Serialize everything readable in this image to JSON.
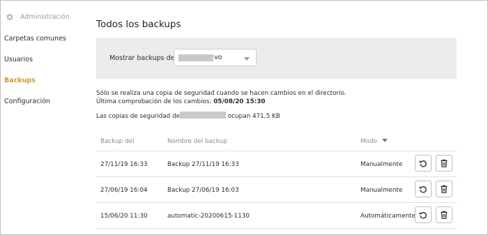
{
  "sidebar": {
    "header": {
      "title": "Administración",
      "icon": "gear-icon"
    },
    "items": [
      {
        "label": "Carpetas comunes",
        "active": false
      },
      {
        "label": "Usuarios",
        "active": false
      },
      {
        "label": "Backups",
        "active": true
      },
      {
        "label": "Configuración",
        "active": false
      }
    ],
    "accent_color": "#e0942a"
  },
  "main": {
    "title": "Todos los backups",
    "filter": {
      "label": "Mostrar backups de",
      "selected_value_visible": "vo"
    },
    "info": {
      "line1": "Sólo se realiza una copia de seguridad cuando se hacen cambios en el directorio.",
      "line2_label": "Última comprobación de los cambios: ",
      "line2_value": "05/08/20 15:30",
      "line3_prefix": "Las copias de seguridad de",
      "line3_suffix": " ocupan 471,5 KB"
    },
    "table": {
      "headers": {
        "date": "Backup del",
        "name": "Nombre del backup",
        "mode": "Modo"
      },
      "rows": [
        {
          "date": "27/11/19 16:33",
          "name": "Backup 27/11/19 16:33",
          "mode": "Manualmente"
        },
        {
          "date": "27/06/19 16:04",
          "name": "Backup 27/06/19 16:03",
          "mode": "Manualmente"
        },
        {
          "date": "15/06/20 11:30",
          "name": "automatic-20200615-1130",
          "mode": "Automáticamente"
        }
      ],
      "row_actions": [
        "restore-icon",
        "delete-icon"
      ]
    }
  }
}
